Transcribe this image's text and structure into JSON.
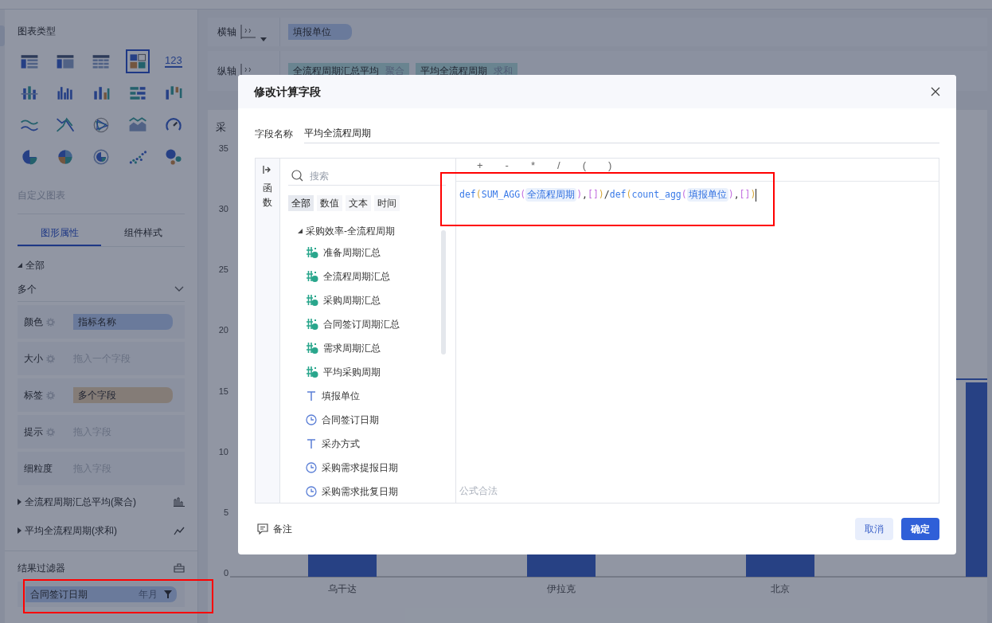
{
  "left_panel": {
    "chart_types_title": "图表类型",
    "chart_types": [
      {
        "kind": "table",
        "selected": false
      },
      {
        "kind": "cross-table",
        "selected": false
      },
      {
        "kind": "detail-table",
        "selected": false
      },
      {
        "kind": "dashboard",
        "selected": true
      },
      {
        "kind": "number",
        "label": "123",
        "selected": false
      },
      {
        "kind": "stacked-bar",
        "selected": false
      },
      {
        "kind": "grouped-bar",
        "selected": false
      },
      {
        "kind": "bar",
        "selected": false
      },
      {
        "kind": "horizontal-bar",
        "selected": false
      },
      {
        "kind": "range-bar",
        "selected": false
      },
      {
        "kind": "line",
        "selected": false
      },
      {
        "kind": "crossing-line",
        "selected": false
      },
      {
        "kind": "radar",
        "selected": false
      },
      {
        "kind": "area",
        "selected": false
      },
      {
        "kind": "gauge",
        "selected": false
      },
      {
        "kind": "pie",
        "selected": false
      },
      {
        "kind": "multi-pie",
        "selected": false
      },
      {
        "kind": "ring",
        "selected": false
      },
      {
        "kind": "scatter",
        "selected": false
      },
      {
        "kind": "bubble",
        "selected": false
      }
    ],
    "custom_chart": "自定义图表",
    "tabs": [
      {
        "label": "图形属性",
        "selected": true
      },
      {
        "label": "组件样式",
        "selected": false
      }
    ],
    "group": {
      "label": "全部",
      "expanded": true
    },
    "mark_type": "多个",
    "properties": [
      {
        "label": "颜色",
        "settings": true,
        "field": "指标名称",
        "kind": "dimension"
      },
      {
        "label": "大小",
        "settings": true,
        "hint": "拖入一个字段"
      },
      {
        "label": "标签",
        "settings": true,
        "field": "多个字段",
        "kind": "multi"
      },
      {
        "label": "提示",
        "settings": true,
        "hint": "拖入字段"
      },
      {
        "label": "细粒度",
        "settings": false,
        "hint": "拖入字段"
      }
    ],
    "measures": [
      {
        "label": "全流程周期汇总平均(聚合)",
        "expanded": false,
        "kind": "bar"
      },
      {
        "label": "平均全流程周期(求和)",
        "expanded": false,
        "kind": "line"
      }
    ],
    "filter_title": "结果过滤器",
    "filters": [
      {
        "field": "合同签订日期",
        "granularity": "年月"
      }
    ]
  },
  "axes": [
    {
      "label": "横轴",
      "dropdown": true,
      "fields": [
        {
          "name": "填报单位",
          "kind": "dimension"
        }
      ]
    },
    {
      "label": "纵轴",
      "dropdown": false,
      "fields": [
        {
          "name": "全流程周期汇总平均",
          "agg": "聚合",
          "kind": "measure"
        },
        {
          "name": "平均全流程周期",
          "agg": "求和",
          "kind": "measure"
        }
      ]
    }
  ],
  "chart": {
    "title": "采",
    "y_ticks": [
      "35",
      "30",
      "25",
      "20",
      "15",
      "10",
      "5",
      "0"
    ],
    "categories": [
      "乌干达",
      "伊拉克",
      "北京"
    ]
  },
  "dialog": {
    "title": "修改计算字段",
    "name_label": "字段名称",
    "name_value": "平均全流程周期",
    "side_tab": "函数",
    "search_placeholder": "搜索",
    "filter_tabs": [
      {
        "label": "全部",
        "selected": true
      },
      {
        "label": "数值",
        "selected": false
      },
      {
        "label": "文本",
        "selected": false
      },
      {
        "label": "时间",
        "selected": false
      }
    ],
    "tree": {
      "label": "采购效率-全流程周期",
      "expanded": true,
      "children": [
        {
          "label": "准备周期汇总",
          "kind": "calculated"
        },
        {
          "label": "全流程周期汇总",
          "kind": "calculated"
        },
        {
          "label": "采购周期汇总",
          "kind": "calculated"
        },
        {
          "label": "合同签订周期汇总",
          "kind": "calculated"
        },
        {
          "label": "需求周期汇总",
          "kind": "calculated"
        },
        {
          "label": "平均采购周期",
          "kind": "calculated"
        },
        {
          "label": "填报单位",
          "kind": "text"
        },
        {
          "label": "合同签订日期",
          "kind": "date"
        },
        {
          "label": "采办方式",
          "kind": "text"
        },
        {
          "label": "采购需求提报日期",
          "kind": "date"
        },
        {
          "label": "采购需求批复日期",
          "kind": "date"
        }
      ]
    },
    "operators": [
      "+",
      "-",
      "*",
      "/",
      "(",
      ")"
    ],
    "formula": [
      {
        "text": "def",
        "kind": "func"
      },
      {
        "text": "(",
        "kind": "paren1"
      },
      {
        "text": "SUM_AGG",
        "kind": "func"
      },
      {
        "text": "(",
        "kind": "paren2"
      },
      {
        "text": "全流程周期",
        "kind": "field"
      },
      {
        "text": ")",
        "kind": "paren2"
      },
      {
        "text": ",",
        "kind": "punct"
      },
      {
        "text": "[]",
        "kind": "paren2"
      },
      {
        "text": ")",
        "kind": "paren1"
      },
      {
        "text": "/",
        "kind": "punct"
      },
      {
        "text": "def",
        "kind": "func"
      },
      {
        "text": "(",
        "kind": "paren1"
      },
      {
        "text": "count_agg",
        "kind": "func"
      },
      {
        "text": "(",
        "kind": "paren2"
      },
      {
        "text": "填报单位",
        "kind": "field"
      },
      {
        "text": ")",
        "kind": "paren2"
      },
      {
        "text": ",",
        "kind": "punct"
      },
      {
        "text": "[]",
        "kind": "paren2"
      },
      {
        "text": ")",
        "kind": "paren1"
      }
    ],
    "status": "公式合法",
    "note": "备注",
    "buttons": [
      {
        "label": "取消",
        "kind": "secondary"
      },
      {
        "label": "确定",
        "kind": "primary"
      }
    ]
  }
}
